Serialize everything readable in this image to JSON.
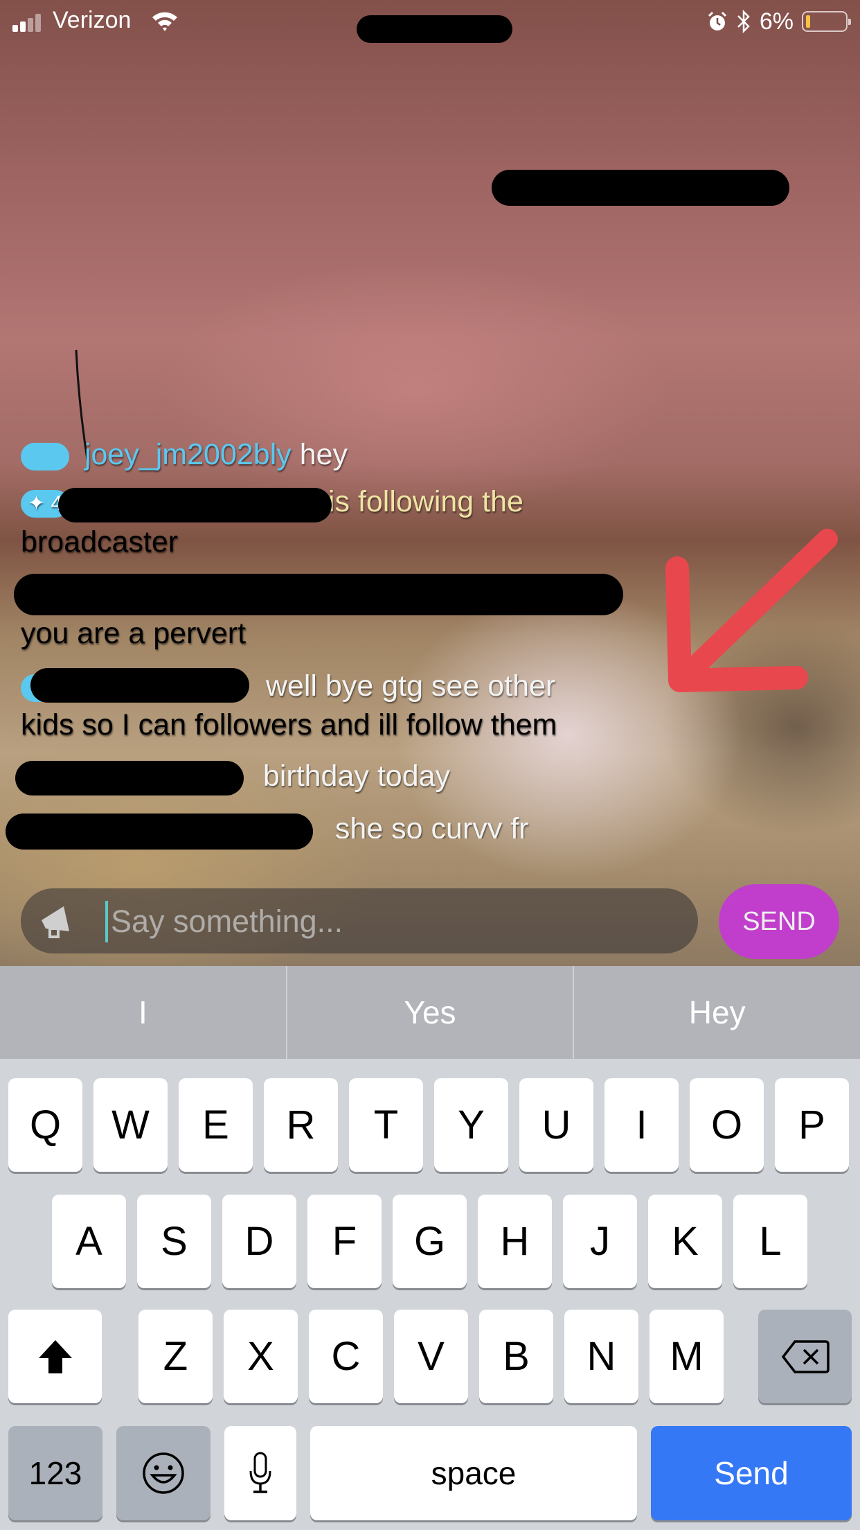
{
  "status_bar": {
    "carrier": "Verizon",
    "battery_percent": "6%",
    "battery_level": 0.06,
    "icons": [
      "signal-icon",
      "wifi-icon",
      "alarm-icon",
      "bluetooth-icon",
      "battery-icon"
    ]
  },
  "chat": {
    "messages": [
      {
        "user": "joey_jm2002bly",
        "text": "hey",
        "type": "message",
        "clipped": true
      },
      {
        "user": "",
        "badge": "4",
        "text_line1": "is following the",
        "text_line2": "broadcaster",
        "type": "system"
      },
      {
        "user": "",
        "text_line1": "",
        "text_line2": "you are a pervert",
        "type": "message"
      },
      {
        "user": "",
        "text_line1": "well bye gtg see other",
        "text_line2": "kids so I can followers and ill follow them",
        "type": "message"
      },
      {
        "user": "",
        "text": "birthday today",
        "type": "message"
      },
      {
        "user": "",
        "text": "she so curvy fr",
        "type": "message"
      }
    ]
  },
  "input": {
    "placeholder": "Say something...",
    "value": "",
    "send_label": "SEND"
  },
  "keyboard": {
    "suggestions": [
      "I",
      "Yes",
      "Hey"
    ],
    "row1": [
      "Q",
      "W",
      "E",
      "R",
      "T",
      "Y",
      "U",
      "I",
      "O",
      "P"
    ],
    "row2": [
      "A",
      "S",
      "D",
      "F",
      "G",
      "H",
      "J",
      "K",
      "L"
    ],
    "row3": [
      "Z",
      "X",
      "C",
      "V",
      "B",
      "N",
      "M"
    ],
    "numbers_label": "123",
    "space_label": "space",
    "send_label": "Send"
  },
  "colors": {
    "accent_send": "#c13ecc",
    "username": "#5bc8f0",
    "system_text": "#efe3a4",
    "keyboard_send": "#3478f6",
    "annotation_arrow": "#e8474d"
  }
}
